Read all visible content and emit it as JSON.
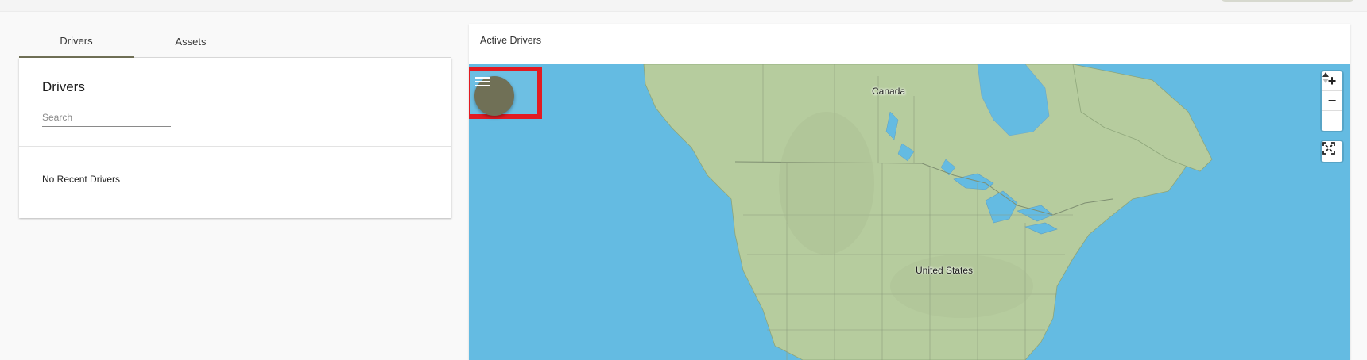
{
  "tabs": [
    {
      "label": "Drivers",
      "active": true
    },
    {
      "label": "Assets",
      "active": false
    }
  ],
  "drivers_card": {
    "title": "Drivers",
    "search_placeholder": "Search",
    "search_value": "",
    "empty_message": "No Recent Drivers"
  },
  "map_panel": {
    "title": "Active Drivers",
    "labels": {
      "canada": "Canada",
      "united_states": "United States"
    },
    "controls": {
      "zoom_in": "+",
      "zoom_out": "−",
      "compass": "▲▼"
    }
  },
  "colors": {
    "accent": "#707056",
    "highlight": "#e21b22",
    "water": "#64bbe2",
    "land": "#b6cc9e"
  },
  "icons": [
    "menu-icon",
    "fullscreen-icon",
    "compass-icon"
  ]
}
